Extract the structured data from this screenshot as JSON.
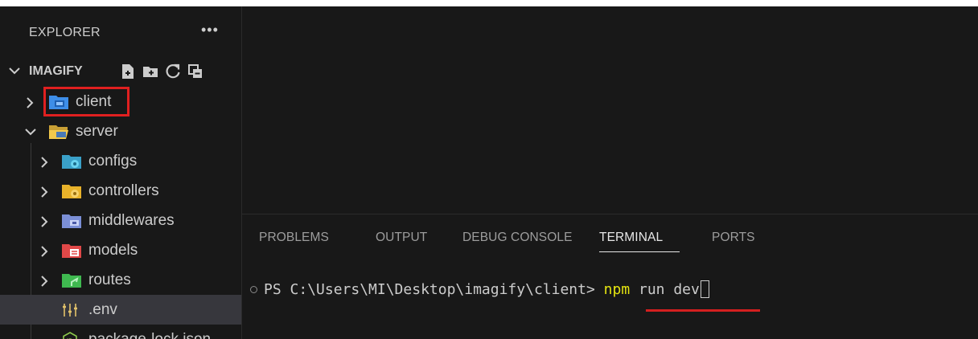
{
  "explorer": {
    "title": "EXPLORER",
    "more": "•••",
    "root_name": "IMAGIFY",
    "actions": [
      "new-file-icon",
      "new-folder-icon",
      "refresh-icon",
      "collapse-all-icon"
    ]
  },
  "tree": [
    {
      "name": "client",
      "type": "folder",
      "expanded": false,
      "icon": "folder-client-icon",
      "highlighted": true
    },
    {
      "name": "server",
      "type": "folder",
      "expanded": true,
      "icon": "folder-server-open-icon"
    },
    {
      "name": "configs",
      "type": "folder",
      "expanded": false,
      "icon": "folder-config-icon"
    },
    {
      "name": "controllers",
      "type": "folder",
      "expanded": false,
      "icon": "folder-controller-icon"
    },
    {
      "name": "middlewares",
      "type": "folder",
      "expanded": false,
      "icon": "folder-middleware-icon"
    },
    {
      "name": "models",
      "type": "folder",
      "expanded": false,
      "icon": "folder-models-icon"
    },
    {
      "name": "routes",
      "type": "folder",
      "expanded": false,
      "icon": "folder-routes-icon"
    },
    {
      "name": ".env",
      "type": "file",
      "icon": "env-file-icon",
      "selected": true
    },
    {
      "name": "package-lock.json",
      "type": "file",
      "icon": "nodejs-file-icon"
    }
  ],
  "panel": {
    "tabs": [
      {
        "label": "PROBLEMS",
        "active": false
      },
      {
        "label": "OUTPUT",
        "active": false
      },
      {
        "label": "DEBUG CONSOLE",
        "active": false
      },
      {
        "label": "TERMINAL",
        "active": true
      },
      {
        "label": "PORTS",
        "active": false
      }
    ],
    "terminal": {
      "prompt": "PS C:\\Users\\MI\\Desktop\\imagify\\client> ",
      "command": "npm",
      "args": " run dev"
    }
  },
  "colors": {
    "background": "#181818",
    "highlight_border": "#e02020",
    "command_color": "#e5e510",
    "underline_color": "#d41f1f"
  }
}
